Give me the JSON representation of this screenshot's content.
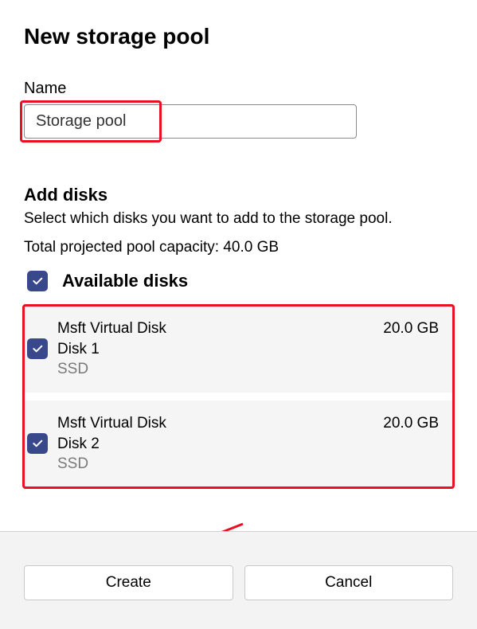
{
  "page_title": "New storage pool",
  "name_section": {
    "label": "Name",
    "value": "Storage pool"
  },
  "disks_section": {
    "heading": "Add disks",
    "description": "Select which disks you want to add to the storage pool.",
    "capacity_line": "Total projected pool capacity: 40.0 GB",
    "available_label": "Available disks",
    "disks": [
      {
        "name": "Msft Virtual Disk",
        "sub": "Disk 1",
        "type": "SSD",
        "size": "20.0 GB"
      },
      {
        "name": "Msft Virtual Disk",
        "sub": "Disk 2",
        "type": "SSD",
        "size": "20.0 GB"
      }
    ]
  },
  "footer": {
    "create_label": "Create",
    "cancel_label": "Cancel"
  }
}
